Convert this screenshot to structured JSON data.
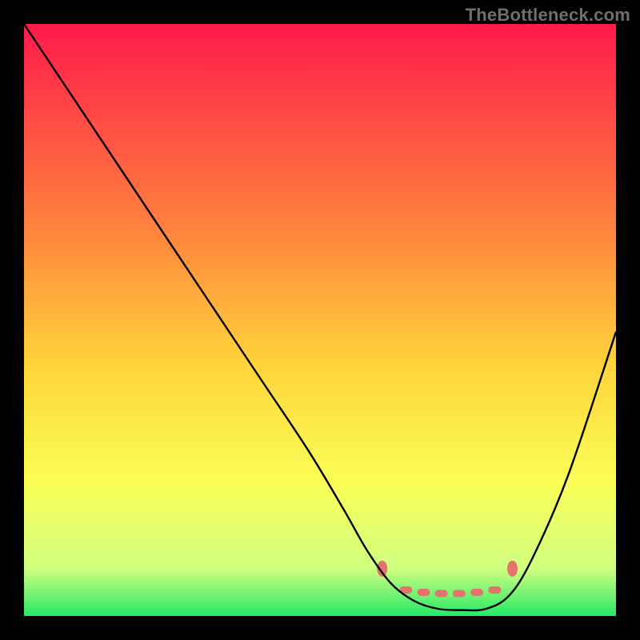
{
  "watermark": "TheBottleneck.com",
  "chart_data": {
    "type": "line",
    "title": "",
    "xlabel": "",
    "ylabel": "",
    "xlim": [
      0,
      100
    ],
    "ylim": [
      0,
      100
    ],
    "series": [
      {
        "name": "curve",
        "x": [
          0,
          8,
          16,
          24,
          32,
          40,
          48,
          54,
          58,
          62,
          66,
          70,
          74,
          78,
          82,
          86,
          92,
          100
        ],
        "y": [
          100,
          88,
          76,
          64,
          52,
          40,
          28,
          18,
          11,
          5.5,
          2.5,
          1.2,
          1.0,
          1.2,
          3.5,
          10,
          24,
          48
        ]
      },
      {
        "name": "green-band",
        "x": [
          0,
          100
        ],
        "y": [
          5,
          5
        ],
        "band_height": 5
      }
    ],
    "markers": [
      {
        "name": "dot-left",
        "x": 60.5,
        "y": 8
      },
      {
        "name": "dot-right",
        "x": 82.5,
        "y": 8
      },
      {
        "name": "dash-1",
        "x": 64.5,
        "y": 4.4
      },
      {
        "name": "dash-2",
        "x": 67.5,
        "y": 4.0
      },
      {
        "name": "dash-3",
        "x": 70.5,
        "y": 3.8
      },
      {
        "name": "dash-4",
        "x": 73.5,
        "y": 3.8
      },
      {
        "name": "dash-5",
        "x": 76.5,
        "y": 4.0
      },
      {
        "name": "dash-6",
        "x": 79.5,
        "y": 4.4
      }
    ],
    "colors": {
      "marker": "#e2746d",
      "curve": "#000000",
      "gradient_top": "#ff1a4b",
      "gradient_mid1": "#ff7d3e",
      "gradient_mid2": "#ffd53a",
      "gradient_mid3": "#faff58",
      "gradient_mid4": "#cfff80",
      "gradient_bot": "#27e867"
    }
  }
}
